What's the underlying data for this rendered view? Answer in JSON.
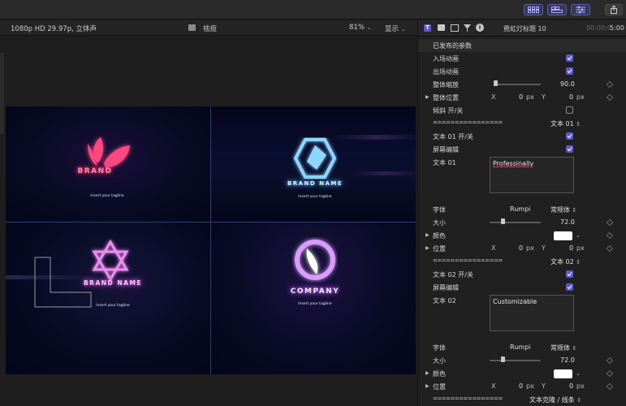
{
  "viewer": {
    "format": "1080p HD 29.97p, 立体声",
    "clip_title": "祛痘",
    "zoom": "81%",
    "display_menu": "显示"
  },
  "canvas": {
    "logos": [
      {
        "brand": "BRAND",
        "tagline": "Insert your tagline",
        "color": "#ff2a6a"
      },
      {
        "brand": "BRAND NAME",
        "tagline": "Insert your tagline",
        "color": "#57b8ff"
      },
      {
        "brand": "BRAND NAME",
        "tagline": "Insert your tagline",
        "color": "#e65ee0"
      },
      {
        "brand": "COMPANY",
        "tagline": "Insert your tagline",
        "color": "#c45cff"
      }
    ]
  },
  "inspector": {
    "title": "霓虹灯标题 10",
    "timecode_dim": "00:00:0",
    "timecode": "5:00",
    "published_params_header": "已发布的参数",
    "rows": {
      "intro_anim": {
        "label": "入场动画",
        "checked": true
      },
      "outro_anim": {
        "label": "出场动画",
        "checked": true
      },
      "overall_scale": {
        "label": "整体缩放",
        "value": "90.0",
        "level": 0.05
      },
      "overall_pos": {
        "label": "整体位置",
        "x_label": "X",
        "x_value": "0",
        "x_unit": "px",
        "y_label": "Y",
        "y_value": "0",
        "y_unit": "px"
      },
      "tilt": {
        "label": "倾斜 开/关",
        "checked": false
      },
      "sep1": {
        "label": "================",
        "value": "文本 01"
      },
      "text01_toggle": {
        "label": "文本 01 开/关",
        "checked": true
      },
      "text01_screen_edit": {
        "label": "屏幕编辑",
        "checked": true
      },
      "text01": {
        "label": "文本 01",
        "value": "Professinally"
      },
      "font1": {
        "label": "字体",
        "family": "Rumpi",
        "style": "常规体"
      },
      "size1": {
        "label": "大小",
        "value": "72.0",
        "level": 0.25
      },
      "color1": {
        "label": "颜色",
        "color": "#ffffff"
      },
      "pos1": {
        "label": "位置",
        "x_label": "X",
        "x_value": "0",
        "x_unit": "px",
        "y_label": "Y",
        "y_value": "0",
        "y_unit": "px"
      },
      "sep2": {
        "label": "================",
        "value": "文本 02"
      },
      "text02_toggle": {
        "label": "文本 02 开/关",
        "checked": true
      },
      "text02_screen_edit": {
        "label": "屏幕编辑",
        "checked": true
      },
      "text02": {
        "label": "文本 02",
        "value": "Customizable"
      },
      "font2": {
        "label": "字体",
        "family": "Rumpi",
        "style": "常规体"
      },
      "size2": {
        "label": "大小",
        "value": "72.0",
        "level": 0.25
      },
      "color2": {
        "label": "颜色",
        "color": "#ffffff"
      },
      "pos2": {
        "label": "位置",
        "x_label": "X",
        "x_value": "0",
        "x_unit": "px",
        "y_label": "Y",
        "y_value": "0",
        "y_unit": "px"
      },
      "sep3": {
        "label": "================",
        "value": "文本克隆 / 线条"
      }
    }
  },
  "icons": {
    "toolbar": [
      "layout-icon",
      "timeline-icon",
      "inspector-adjust-icon",
      "share-icon"
    ],
    "inspector_tabs": [
      "title-tab-icon",
      "text-tab-icon",
      "video-tab-icon",
      "filter-tab-icon",
      "info-tab-icon"
    ]
  },
  "colors": {
    "accent": "#5a57d6"
  }
}
